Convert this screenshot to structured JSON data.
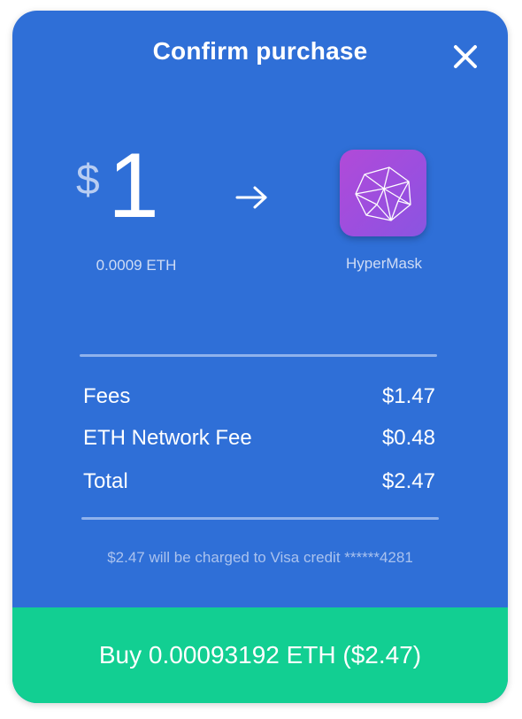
{
  "header": {
    "title": "Confirm purchase",
    "close_icon": "close-icon"
  },
  "purchase": {
    "currency_symbol": "$",
    "amount": "1",
    "eth_equivalent": "0.0009 ETH",
    "arrow_icon": "arrow-right-icon",
    "app_icon": "hypermask-logo-icon",
    "app_name": "HyperMask"
  },
  "fees": [
    {
      "label": "Fees",
      "value": "$1.47"
    },
    {
      "label": "ETH Network Fee",
      "value": "$0.48"
    },
    {
      "label": "Total",
      "value": "$2.47"
    }
  ],
  "charge_note": "$2.47 will be charged to Visa credit ******4281",
  "buy_button": {
    "label": "Buy 0.00093192 ETH ($2.47)"
  },
  "colors": {
    "card_background": "#2f6fd7",
    "buy_button": "#12cf92",
    "app_icon": "#a34edc"
  }
}
